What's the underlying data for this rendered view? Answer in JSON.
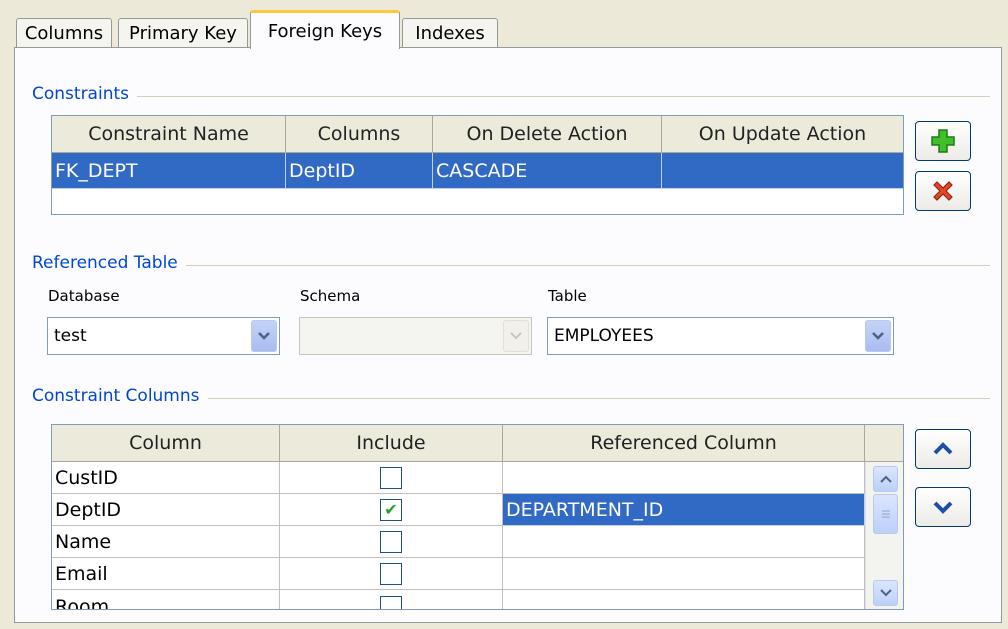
{
  "tabs": [
    {
      "label": "Columns",
      "active": false
    },
    {
      "label": "Primary Key",
      "active": false
    },
    {
      "label": "Foreign Keys",
      "active": true
    },
    {
      "label": "Indexes",
      "active": false
    }
  ],
  "constraints": {
    "title": "Constraints",
    "headers": [
      "Constraint Name",
      "Columns",
      "On Delete Action",
      "On Update Action"
    ],
    "rows": [
      {
        "name": "FK_DEPT",
        "columns": "DeptID",
        "on_delete": "CASCADE",
        "on_update": "",
        "selected": true
      }
    ],
    "add_icon": "plus-icon",
    "remove_icon": "delete-x-icon"
  },
  "referenced_table": {
    "title": "Referenced Table",
    "database_label": "Database",
    "database_value": "test",
    "schema_label": "Schema",
    "schema_value": "",
    "table_label": "Table",
    "table_value": "EMPLOYEES"
  },
  "constraint_columns": {
    "title": "Constraint Columns",
    "headers": [
      "Column",
      "Include",
      "Referenced Column"
    ],
    "rows": [
      {
        "column": "CustID",
        "include": false,
        "referenced": ""
      },
      {
        "column": "DeptID",
        "include": true,
        "referenced": "DEPARTMENT_ID",
        "selected": true
      },
      {
        "column": "Name",
        "include": false,
        "referenced": ""
      },
      {
        "column": "Email",
        "include": false,
        "referenced": ""
      },
      {
        "column": "Room",
        "include": false,
        "referenced": ""
      }
    ],
    "move_up_icon": "chevron-up-icon",
    "move_down_icon": "chevron-down-icon"
  },
  "colors": {
    "selection": "#316ac5",
    "group_title": "#0046d5",
    "active_tab_accent": "#ffc83c"
  }
}
